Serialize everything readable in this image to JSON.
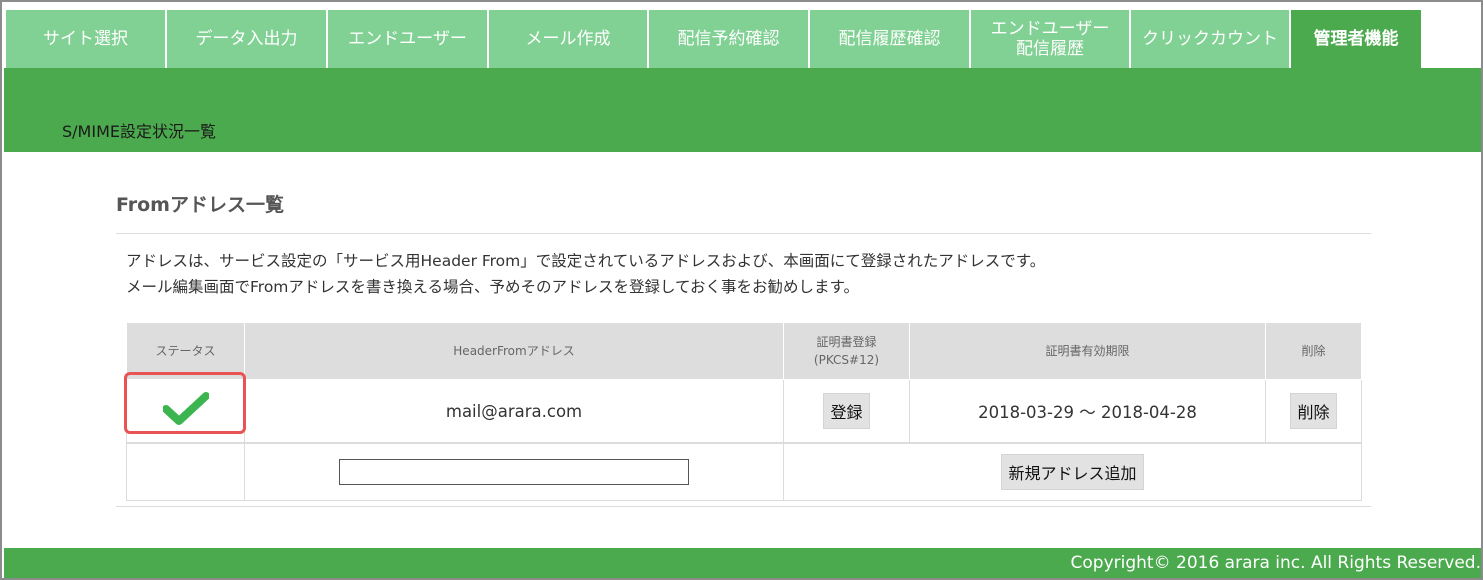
{
  "nav": {
    "tabs": [
      {
        "label": "サイト選択",
        "active": false
      },
      {
        "label": "データ入出力",
        "active": false
      },
      {
        "label": "エンドユーザー",
        "active": false
      },
      {
        "label": "メール作成",
        "active": false
      },
      {
        "label": "配信予約確認",
        "active": false
      },
      {
        "label": "配信履歴確認",
        "active": false
      },
      {
        "label": "エンドユーザー\n配信履歴",
        "active": false
      },
      {
        "label": "クリックカウント",
        "active": false
      },
      {
        "label": "管理者機能",
        "active": true
      }
    ]
  },
  "page": {
    "subtitle": "S/MIME設定状況一覧",
    "section_title": "Fromアドレス一覧",
    "description": [
      "アドレスは、サービス設定の「サービス用Header From」で設定されているアドレスおよび、本画面にて登録されたアドレスです。",
      "メール編集画面でFromアドレスを書き換える場合、予めそのアドレスを登録しておく事をお勧めします。"
    ]
  },
  "table": {
    "headers": {
      "status": "ステータス",
      "address": "HeaderFromアドレス",
      "cert_register_line1": "証明書登録",
      "cert_register_line2": "(PKCS#12)",
      "validity": "証明書有効期限",
      "delete": "削除"
    },
    "rows": [
      {
        "status_icon": "checkmark-icon",
        "address": "mail@arara.com",
        "register_button": "登録",
        "validity": "2018-03-29 ～ 2018-04-28",
        "delete_button": "削除"
      }
    ],
    "new_row": {
      "input_value": "",
      "add_button": "新規アドレス追加"
    }
  },
  "footer": {
    "copyright": "Copyright© 2016 arara inc. All Rights Reserved."
  },
  "colors": {
    "tab": "#82d194",
    "active_tab": "#4caa4e",
    "band": "#4caa4e",
    "check": "#3cb550",
    "highlight": "#ea5353"
  }
}
